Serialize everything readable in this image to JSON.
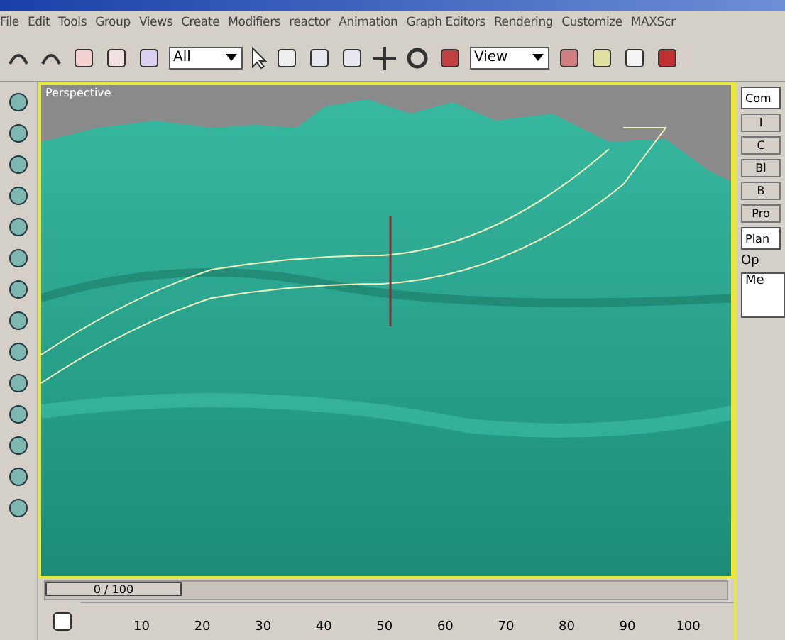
{
  "menu": [
    "File",
    "Edit",
    "Tools",
    "Group",
    "Views",
    "Create",
    "Modifiers",
    "reactor",
    "Animation",
    "Graph Editors",
    "Rendering",
    "Customize",
    "MAXScr"
  ],
  "toolbar": {
    "selection_filter": "All",
    "reference_coord": "View"
  },
  "viewport": {
    "label": "Perspective"
  },
  "command_panel": {
    "dropdown": "Com",
    "buttons": [
      "I",
      "C",
      "Bl",
      "B",
      "Pro"
    ],
    "list_dropdown": "Plan",
    "group_title": "Op",
    "list_item": "Me"
  },
  "time_slider": {
    "reading": "0 / 100",
    "level": 0
  },
  "track_bar": {
    "ticks": [
      "10",
      "20",
      "30",
      "40",
      "50",
      "60",
      "70",
      "80",
      "90",
      "100"
    ]
  }
}
